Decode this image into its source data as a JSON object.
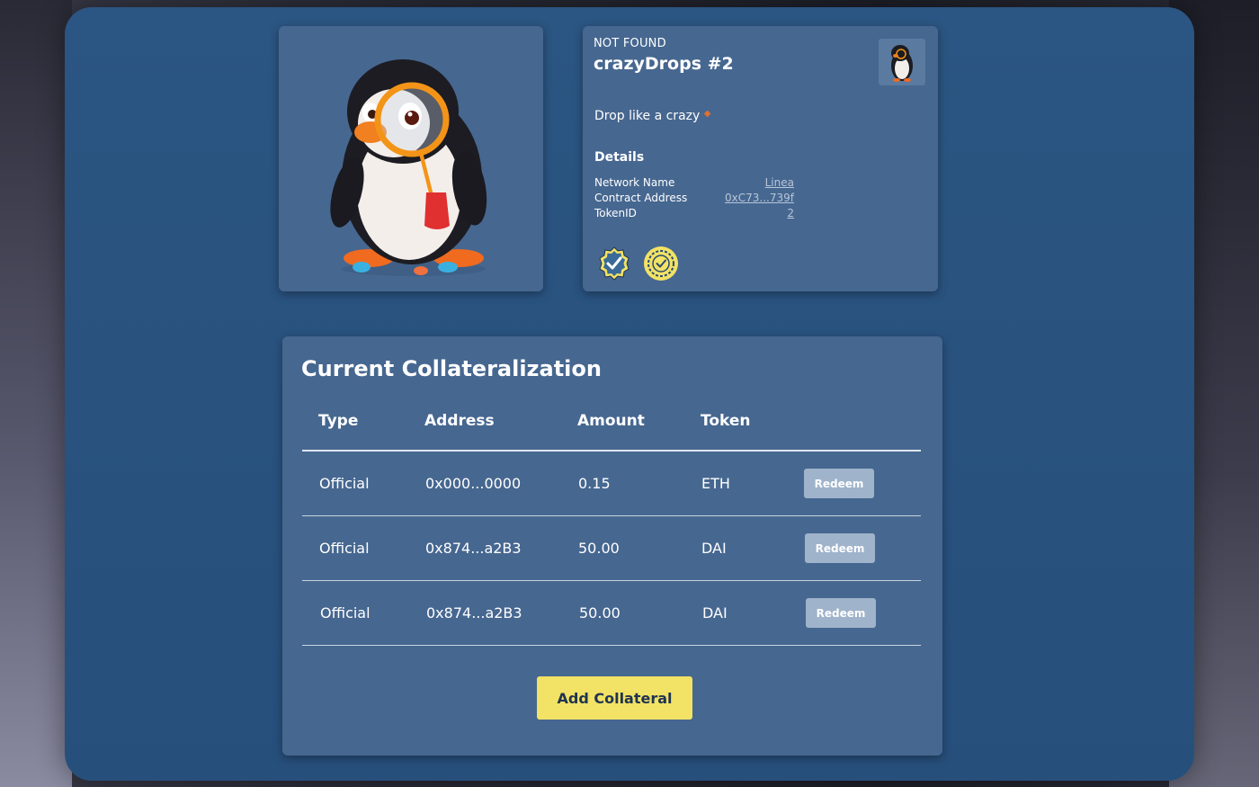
{
  "nft": {
    "status": "NOT FOUND",
    "title": "crazyDrops #2",
    "description": "Drop like a crazy",
    "details_heading": "Details",
    "details": [
      {
        "label": "Network Name",
        "value": "Linea"
      },
      {
        "label": "Contract Address",
        "value": "0xC73...739f"
      },
      {
        "label": "TokenID",
        "value": "2"
      }
    ]
  },
  "collateral": {
    "title": "Current Collateralization",
    "columns": [
      "Type",
      "Address",
      "Amount",
      "Token"
    ],
    "rows": [
      {
        "type": "Official",
        "address": "0x000...0000",
        "amount": "0.15",
        "token": "ETH",
        "action": "Redeem"
      },
      {
        "type": "Official",
        "address": "0x874...a2B3",
        "amount": "50.00",
        "token": "DAI",
        "action": "Redeem"
      },
      {
        "type": "Official",
        "address": "0x874...a2B3",
        "amount": "50.00",
        "token": "DAI",
        "action": "Redeem"
      }
    ],
    "add_button": "Add Collateral"
  },
  "icons": {
    "verified_badge": "verified-badge-icon",
    "certified_seal": "certified-seal-icon"
  },
  "colors": {
    "panel": "#2b5582",
    "card": "#466790",
    "accent_button": "#f2e265",
    "redeem_button": "#9fb3cb"
  }
}
